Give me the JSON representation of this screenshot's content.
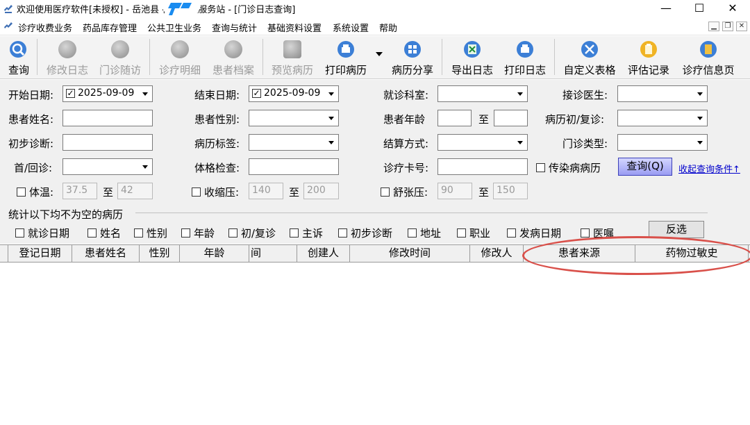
{
  "window": {
    "title": "欢迎使用医疗软件[未授权] - 岳池县    社区卫生服务站 - [门诊日志查询]",
    "min_glyph": "—",
    "max_glyph": "☐",
    "close_glyph": "✕"
  },
  "menu": {
    "items": [
      "诊疗收费业务",
      "药品库存管理",
      "公共卫生业务",
      "查询与统计",
      "基础资料设置",
      "系统设置",
      "帮助"
    ],
    "mdi_min": "▁",
    "mdi_restore": "❐",
    "mdi_close": "✕"
  },
  "toolbar": {
    "query": "查询",
    "edit_log": "修改日志",
    "followup": "门诊随访",
    "detail": "诊疗明细",
    "patient_file": "患者档案",
    "preview": "预览病历",
    "print_record": "打印病历",
    "share": "病历分享",
    "export_log": "导出日志",
    "print_log": "打印日志",
    "custom_table": "自定义表格",
    "assess": "评估记录",
    "info_page": "诊疗信息页"
  },
  "form": {
    "start_date_label": "开始日期:",
    "start_date_value": "2025-09-09",
    "end_date_label": "结束日期:",
    "end_date_value": "2025-09-09",
    "dept_label": "就诊科室:",
    "doctor_label": "接诊医生:",
    "name_label": "患者姓名:",
    "gender_label": "患者性别:",
    "age_label": "患者年龄",
    "to": "至",
    "visit_type_label": "病历初/复诊:",
    "diagnosis_label": "初步诊断:",
    "tag_label": "病历标签:",
    "settle_label": "结算方式:",
    "outpatient_type_label": "门诊类型:",
    "first_return_label": "首/回诊:",
    "physical_label": "体格检查:",
    "card_label": "诊疗卡号:",
    "infectious_label": "传染病病历",
    "query_button": "查询(Q)",
    "collapse_link": "收起查询条件↑",
    "temp_label": "体温:",
    "temp_min": "37.5",
    "temp_max": "42",
    "systolic_label": "收缩压:",
    "systolic_min": "140",
    "systolic_max": "200",
    "diastolic_label": "舒张压:",
    "diastolic_min": "90",
    "diastolic_max": "150",
    "stats_title": "统计以下均不为空的病历",
    "stats_fields": [
      "就诊日期",
      "姓名",
      "性别",
      "年龄",
      "初/复诊",
      "主诉",
      "初步诊断",
      "地址",
      "职业",
      "发病日期",
      "医嘱"
    ],
    "invert_button": "反选"
  },
  "grid": {
    "columns": [
      "",
      "登记日期",
      "患者姓名",
      "性别",
      "年龄",
      "间",
      "创建人",
      "修改时间",
      "修改人",
      "患者来源",
      "药物过敏史"
    ]
  },
  "colors": {
    "annotation": "#d9504a",
    "query_button": "#9a9cf2",
    "link": "#0000cc"
  }
}
